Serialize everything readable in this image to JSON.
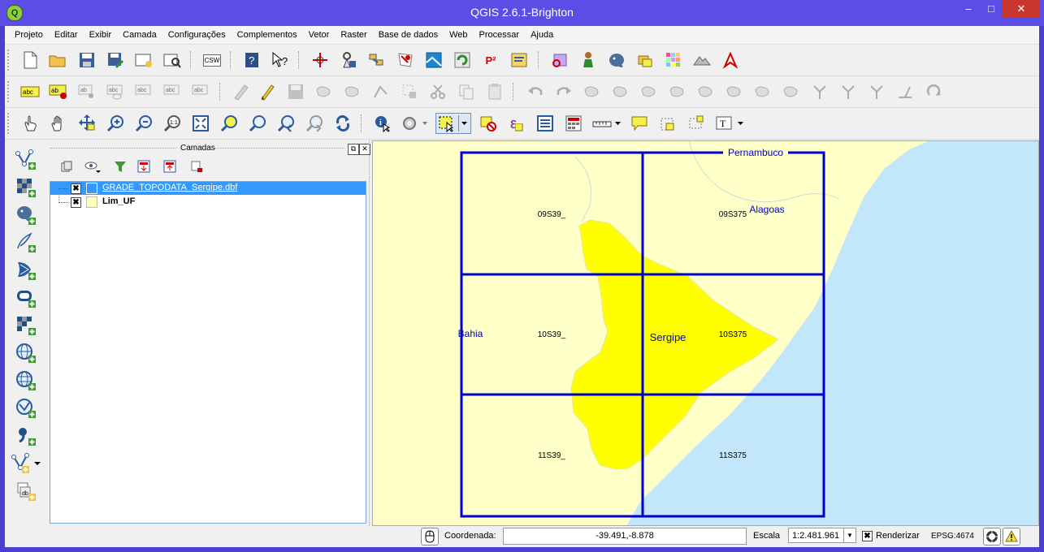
{
  "window": {
    "title": "QGIS 2.6.1-Brighton",
    "app_icon_letter": "Q"
  },
  "menu": [
    "Projeto",
    "Editar",
    "Exibir",
    "Camada",
    "Configurações",
    "Complementos",
    "Vetor",
    "Raster",
    "Base de dados",
    "Web",
    "Processar",
    "Ajuda"
  ],
  "toolbar_text": {
    "csw": "CSW",
    "p2": "P²",
    "epsilon": "ε",
    "text_tool": "T"
  },
  "layers_panel": {
    "title": "Camadas",
    "layers": [
      {
        "name": "GRADE_TOPODATA_Sergipe.dbf",
        "checked": "✖",
        "selected": true,
        "color": "#3399ff"
      },
      {
        "name": "Lim_UF",
        "checked": "✖",
        "selected": false,
        "color": "#ffffc0"
      }
    ]
  },
  "map": {
    "colors": {
      "ocean": "#c2e6fa",
      "land": "#ffffc8",
      "sergipe": "#ffff00",
      "grid": "#0000cc",
      "label": "#0000cc"
    },
    "state_labels": [
      "Pernambuco",
      "Alagoas",
      "Bahia",
      "Sergipe"
    ],
    "cell_labels": [
      "09S39_",
      "09S375",
      "10S39_",
      "10S375",
      "11S39_",
      "11S375"
    ]
  },
  "status": {
    "coord_label": "Coordenada:",
    "coord_value": "-39.491,-8.878",
    "scale_label": "Escala",
    "scale_value": "1:2.481.961",
    "render_label": "Renderizar",
    "render_checked": "✖",
    "crs": "EPSG:4674"
  }
}
